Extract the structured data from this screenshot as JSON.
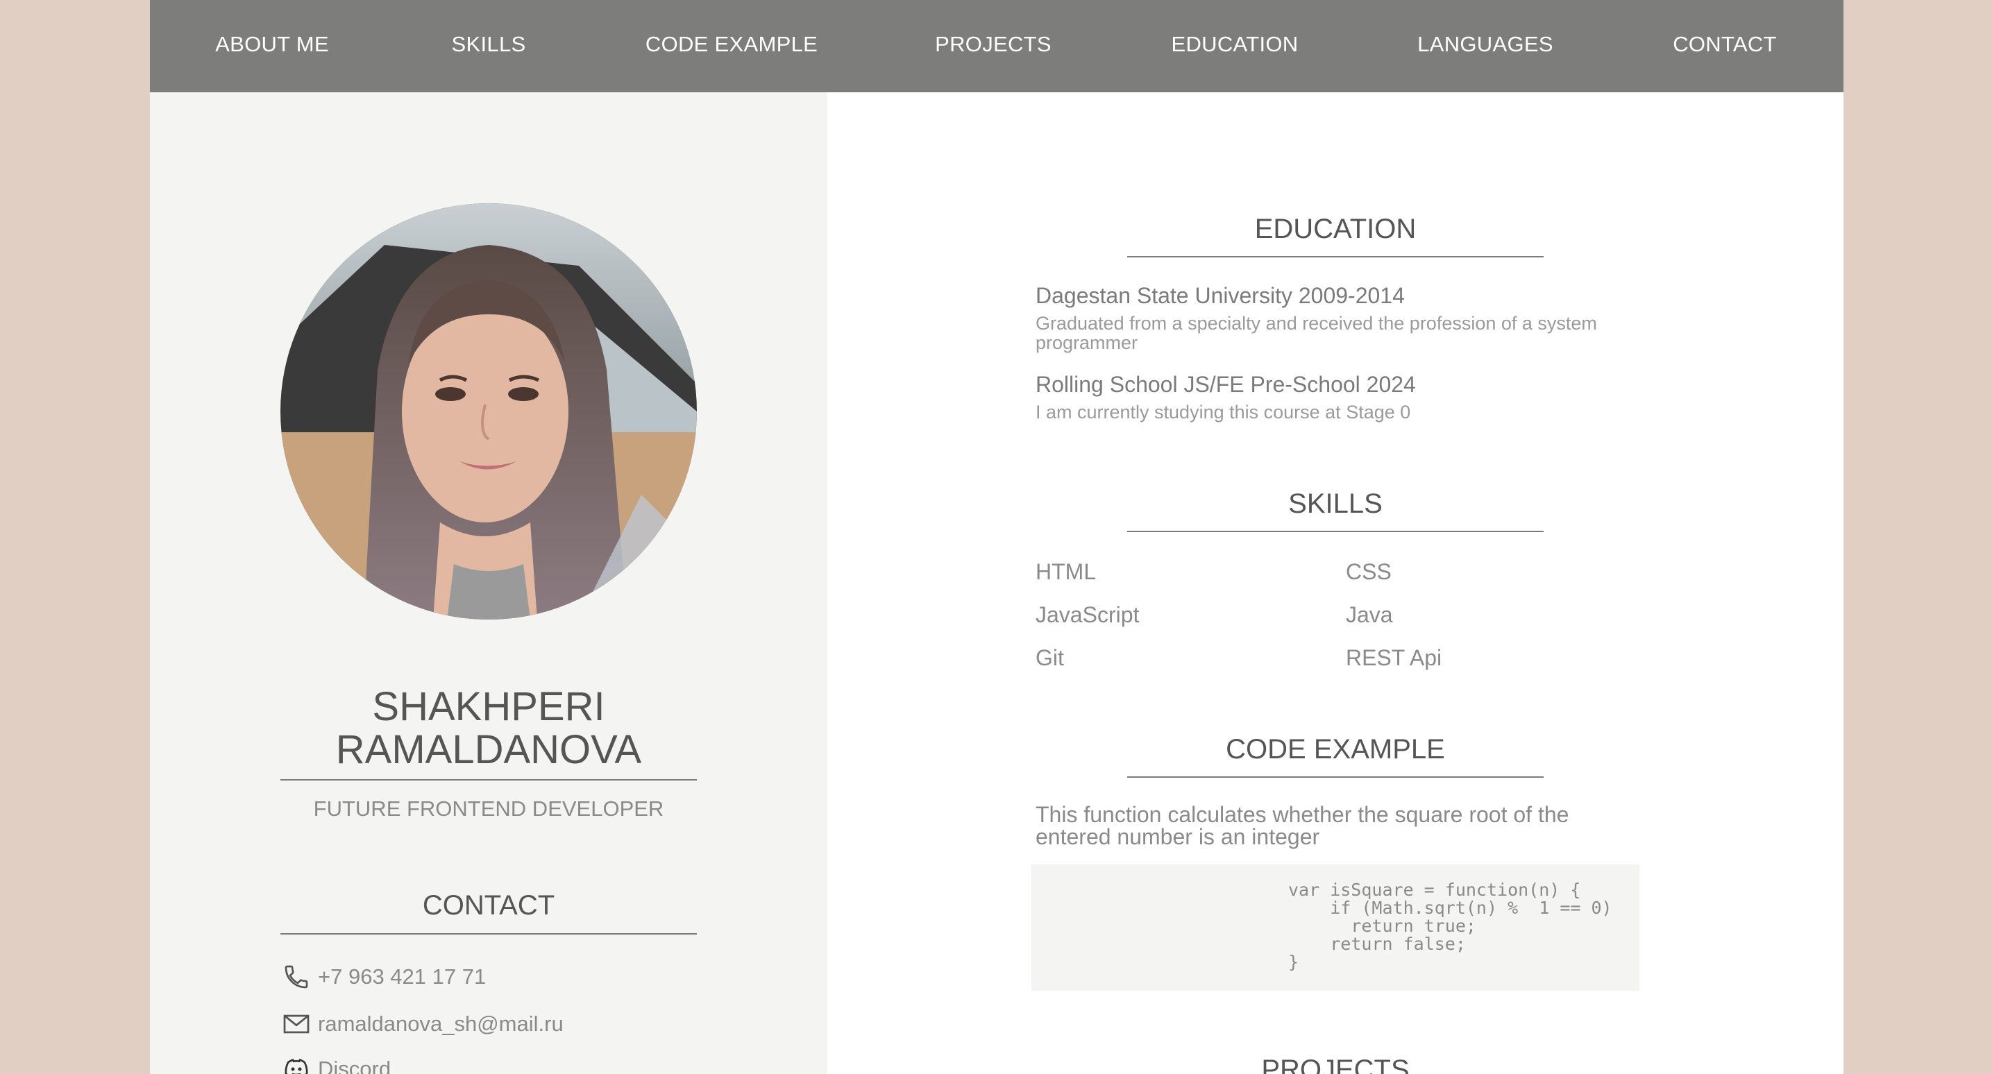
{
  "nav": {
    "items": [
      {
        "label": "ABOUT ME"
      },
      {
        "label": "SKILLS"
      },
      {
        "label": "CODE EXAMPLE"
      },
      {
        "label": "PROJECTS"
      },
      {
        "label": "EDUCATION"
      },
      {
        "label": "LANGUAGES"
      },
      {
        "label": "CONTACT"
      }
    ]
  },
  "profile": {
    "name_line1": "SHAKHPERI",
    "name_line2": "RAMALDANOVA",
    "role": "FUTURE FRONTEND DEVELOPER"
  },
  "contact": {
    "title": "CONTACT",
    "phone": "+7 963 421 17 71",
    "email": "ramaldanova_sh@mail.ru",
    "discord": "Discord"
  },
  "education": {
    "title": "EDUCATION",
    "items": [
      {
        "title": "Dagestan State University 2009-2014",
        "desc": "Graduated from a specialty and received the profession of a system programmer"
      },
      {
        "title": "Rolling School JS/FE Pre-School 2024",
        "desc": "I am currently studying this course at Stage 0"
      }
    ]
  },
  "skills": {
    "title": "SKILLS",
    "items": [
      "HTML",
      "CSS",
      "JavaScript",
      "Java",
      "Git",
      "REST Api"
    ]
  },
  "code_example": {
    "title": "CODE EXAMPLE",
    "desc": "This function calculates whether the square root of the entered number is an integer",
    "code": "var isSquare = function(n) {\n    if (Math.sqrt(n) %  1 == 0)\n      return true;\n    return false;\n}"
  },
  "projects": {
    "title": "PROJECTS"
  },
  "colors": {
    "background": "#e2cfc4",
    "nav": "#7d7d7b",
    "left_panel": "#f4f4f2"
  }
}
